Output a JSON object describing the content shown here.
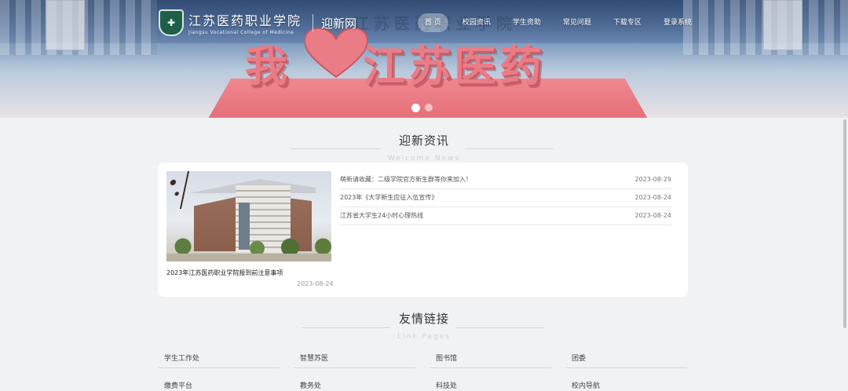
{
  "header": {
    "school_name": "江苏医药职业学院",
    "school_name_en": "Jiangsu Vocational College of Medicine",
    "subsite": "迎新网",
    "nav": [
      {
        "label": "首 页",
        "active": true
      },
      {
        "label": "校园资讯"
      },
      {
        "label": "学生资助"
      },
      {
        "label": "常见问题"
      },
      {
        "label": "下载专区"
      },
      {
        "label": "登录系统"
      }
    ]
  },
  "banner": {
    "slogan_left": "我",
    "slogan_right": "江苏医药",
    "watermark": "江苏医药职业学院",
    "slides": 2,
    "active_slide": 1
  },
  "news": {
    "title": "迎新资讯",
    "subtitle": "Welcome News",
    "feature": {
      "title": "2023年江苏医药职业学院报到前注意事项",
      "date": "2023-08-24"
    },
    "items": [
      {
        "title": "萌新请收藏：二级学院官方新生群等你来加入！",
        "date": "2023-08-29"
      },
      {
        "title": "2023年《大学新生应征入伍宣传》",
        "date": "2023-08-24"
      },
      {
        "title": "江苏省大学生24小时心理热线",
        "date": "2023-08-24"
      }
    ]
  },
  "links": {
    "title": "友情链接",
    "subtitle": "Link Pages",
    "items": [
      "学生工作处",
      "智慧苏医",
      "图书馆",
      "团委",
      "缴费平台",
      "教务处",
      "科技处",
      "校内导航"
    ]
  },
  "colors": {
    "slogan": "#ea7c86",
    "page_bg": "#f1f2f4",
    "card_bg": "#ffffff"
  }
}
